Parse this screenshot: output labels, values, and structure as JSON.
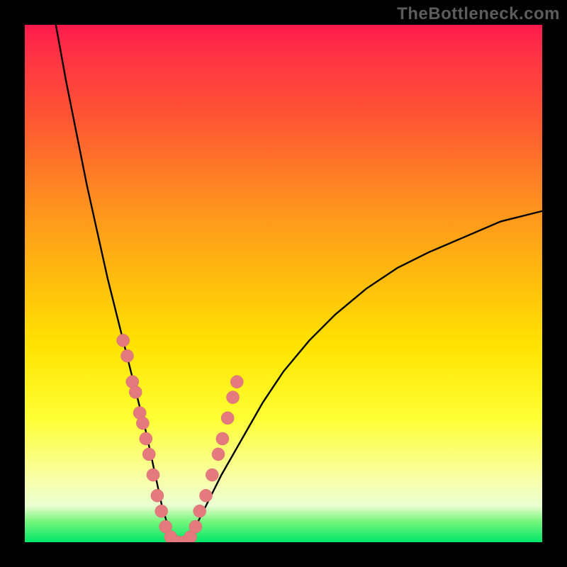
{
  "watermark": "TheBottleneck.com",
  "chart_data": {
    "type": "line",
    "title": "",
    "xlabel": "",
    "ylabel": "",
    "xlim": [
      0,
      100
    ],
    "ylim": [
      0,
      100
    ],
    "grid": false,
    "legend": false,
    "background_gradient": {
      "direction": "vertical",
      "stops": [
        {
          "pos": 0,
          "color": "#ff1a4d"
        },
        {
          "pos": 18,
          "color": "#ff5533"
        },
        {
          "pos": 46,
          "color": "#ffb311"
        },
        {
          "pos": 76,
          "color": "#feff33"
        },
        {
          "pos": 96,
          "color": "#76f57c"
        },
        {
          "pos": 100,
          "color": "#00e868"
        }
      ]
    },
    "series": [
      {
        "name": "bottleneck-curve",
        "x": [
          6,
          8,
          10,
          12,
          14,
          16,
          18,
          20,
          22,
          23.5,
          25,
          26.5,
          28,
          30,
          32.5,
          35,
          38,
          42,
          46,
          50,
          55,
          60,
          66,
          72,
          78,
          85,
          92,
          100
        ],
        "y": [
          100,
          89,
          79,
          69,
          60,
          51,
          43,
          35,
          27,
          21,
          14,
          7,
          2,
          0,
          2,
          7,
          13,
          20,
          27,
          33,
          39,
          44,
          49,
          53,
          56,
          59,
          62,
          64
        ]
      }
    ],
    "markers": [
      {
        "x": 19.0,
        "y": 39
      },
      {
        "x": 19.8,
        "y": 36
      },
      {
        "x": 20.8,
        "y": 31
      },
      {
        "x": 21.4,
        "y": 29
      },
      {
        "x": 22.2,
        "y": 25
      },
      {
        "x": 22.8,
        "y": 23
      },
      {
        "x": 23.4,
        "y": 20
      },
      {
        "x": 24.0,
        "y": 17
      },
      {
        "x": 24.8,
        "y": 13
      },
      {
        "x": 25.6,
        "y": 9
      },
      {
        "x": 26.4,
        "y": 6
      },
      {
        "x": 27.2,
        "y": 3
      },
      {
        "x": 28.2,
        "y": 1
      },
      {
        "x": 29.5,
        "y": 0
      },
      {
        "x": 30.8,
        "y": 0
      },
      {
        "x": 32.0,
        "y": 1
      },
      {
        "x": 33.0,
        "y": 3
      },
      {
        "x": 33.8,
        "y": 6
      },
      {
        "x": 35.0,
        "y": 9
      },
      {
        "x": 36.2,
        "y": 13
      },
      {
        "x": 37.4,
        "y": 17
      },
      {
        "x": 38.2,
        "y": 20
      },
      {
        "x": 39.2,
        "y": 24
      },
      {
        "x": 40.2,
        "y": 28
      },
      {
        "x": 41.0,
        "y": 31
      }
    ]
  }
}
